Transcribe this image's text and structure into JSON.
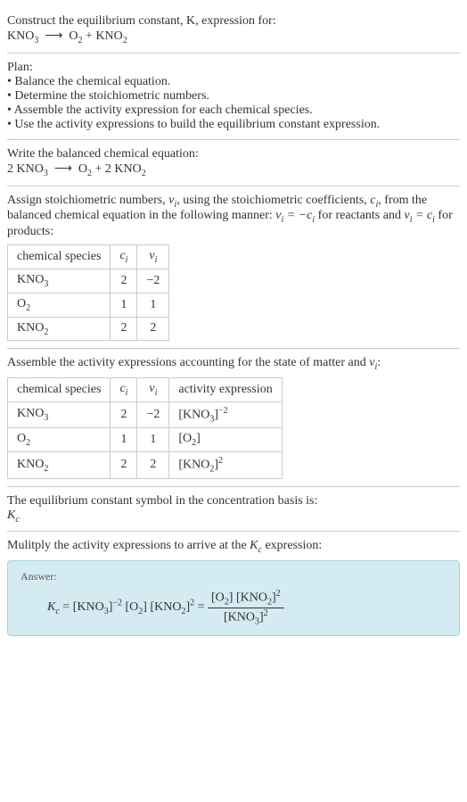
{
  "s1": {
    "line1": "Construct the equilibrium constant, K, expression for:",
    "eq": "KNO₃ ⟶ O₂ + KNO₂"
  },
  "s2": {
    "title": "Plan:",
    "b1": "• Balance the chemical equation.",
    "b2": "• Determine the stoichiometric numbers.",
    "b3": "• Assemble the activity expression for each chemical species.",
    "b4": "• Use the activity expressions to build the equilibrium constant expression."
  },
  "s3": {
    "line1": "Write the balanced chemical equation:",
    "eq": "2 KNO₃ ⟶ O₂ + 2 KNO₂"
  },
  "s4": {
    "intro_a": "Assign stoichiometric numbers, ",
    "intro_b": ", using the stoichiometric coefficients, ",
    "intro_c": ", from the balanced chemical equation in the following manner: ",
    "intro_d": " for reactants and ",
    "intro_e": " for products:",
    "h1": "chemical species",
    "h2": "cᵢ",
    "h3": "νᵢ",
    "r1c1": "KNO₃",
    "r1c2": "2",
    "r1c3": "−2",
    "r2c1": "O₂",
    "r2c2": "1",
    "r2c3": "1",
    "r3c1": "KNO₂",
    "r3c2": "2",
    "r3c3": "2"
  },
  "s5": {
    "intro": "Assemble the activity expressions accounting for the state of matter and νᵢ:",
    "h1": "chemical species",
    "h2": "cᵢ",
    "h3": "νᵢ",
    "h4": "activity expression",
    "r1c1": "KNO₃",
    "r1c2": "2",
    "r1c3": "−2",
    "r2c1": "O₂",
    "r2c2": "1",
    "r2c3": "1",
    "r3c1": "KNO₂",
    "r3c2": "2",
    "r3c3": "2"
  },
  "s6": {
    "line1": "The equilibrium constant symbol in the concentration basis is:",
    "sym": "K",
    "symsub": "c"
  },
  "s7": {
    "line1": "Mulitply the activity expressions to arrive at the ",
    "line1b": " expression:"
  },
  "ans": {
    "label": "Answer:"
  }
}
